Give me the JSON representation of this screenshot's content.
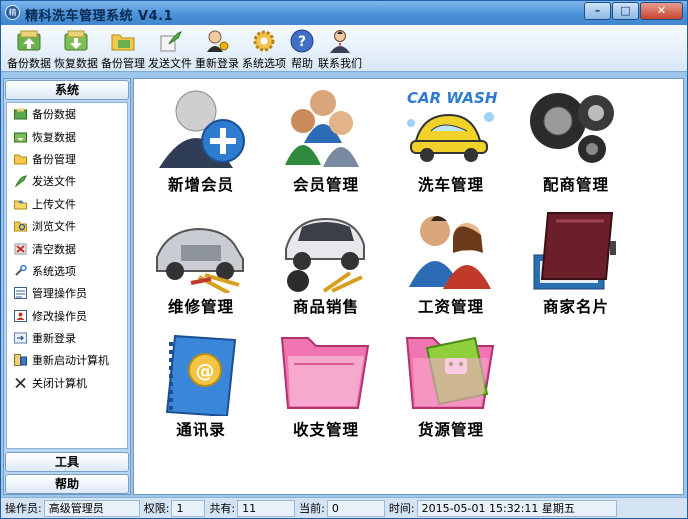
{
  "window": {
    "title": "精科洗车管理系统 V4.1",
    "app_icon": "精"
  },
  "toolbar": {
    "buttons": [
      {
        "label": "备份数据",
        "icon": "backup-icon"
      },
      {
        "label": "恢复数据",
        "icon": "restore-icon"
      },
      {
        "label": "备份管理",
        "icon": "backup-manage-icon"
      },
      {
        "label": "发送文件",
        "icon": "send-file-icon"
      },
      {
        "label": "重新登录",
        "icon": "relogin-icon"
      },
      {
        "label": "系统选项",
        "icon": "gear-icon"
      },
      {
        "label": "帮助",
        "icon": "help-icon"
      },
      {
        "label": "联系我们",
        "icon": "contact-icon"
      }
    ]
  },
  "sidebar": {
    "header": "系统",
    "items": [
      {
        "label": "备份数据",
        "icon": "backup-icon"
      },
      {
        "label": "恢复数据",
        "icon": "restore-icon"
      },
      {
        "label": "备份管理",
        "icon": "folder-icon"
      },
      {
        "label": "发送文件",
        "icon": "send-file-icon"
      },
      {
        "label": "上传文件",
        "icon": "upload-icon"
      },
      {
        "label": "浏览文件",
        "icon": "browse-icon"
      },
      {
        "label": "清空数据",
        "icon": "clear-icon"
      },
      {
        "label": "系统选项",
        "icon": "options-icon"
      },
      {
        "label": "管理操作员",
        "icon": "operators-icon"
      },
      {
        "label": "修改操作员",
        "icon": "edit-operator-icon"
      },
      {
        "label": "重新登录",
        "icon": "relogin-icon"
      },
      {
        "label": "重新启动计算机",
        "icon": "restart-icon"
      },
      {
        "label": "关闭计算机",
        "icon": "shutdown-icon"
      }
    ],
    "footer_tools": "工具",
    "footer_help": "帮助"
  },
  "modules": [
    {
      "label": "新增会员",
      "icon": "add-member-icon"
    },
    {
      "label": "会员管理",
      "icon": "members-icon"
    },
    {
      "label": "洗车管理",
      "icon": "car-wash-icon"
    },
    {
      "label": "配商管理",
      "icon": "tire-icon"
    },
    {
      "label": "维修管理",
      "icon": "repair-icon"
    },
    {
      "label": "商品销售",
      "icon": "sales-icon"
    },
    {
      "label": "工资管理",
      "icon": "salary-icon"
    },
    {
      "label": "商家名片",
      "icon": "business-card-icon"
    },
    {
      "label": "通讯录",
      "icon": "address-book-icon"
    },
    {
      "label": "收支管理",
      "icon": "income-expense-icon"
    },
    {
      "label": "货源管理",
      "icon": "supply-icon"
    }
  ],
  "car_wash_text": "CAR WASH",
  "status": {
    "operator_label": "操作员:",
    "operator_value": "高级管理员",
    "permission_label": "权限:",
    "permission_value": "1",
    "total_label": "共有:",
    "total_value": "11",
    "current_label": "当前:",
    "current_value": "0",
    "time_label": "时间:",
    "time_value": "2015-05-01 15:32:11 星期五"
  }
}
